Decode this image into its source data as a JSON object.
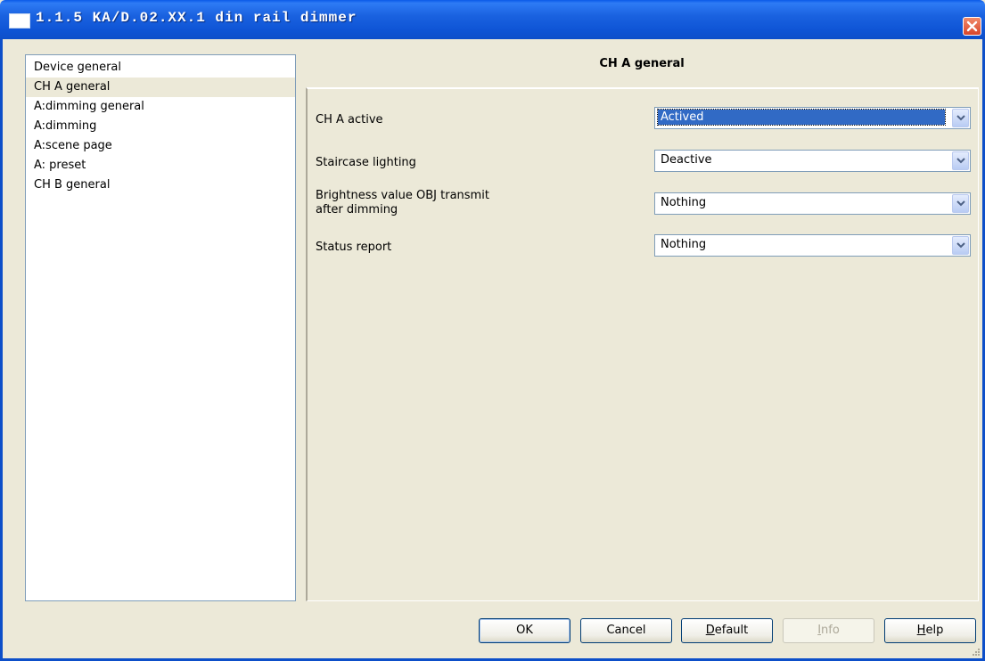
{
  "window": {
    "title": "1.1.5 KA/D.02.XX.1 din rail dimmer",
    "title_icon": "window-icon",
    "close_icon": "close-icon"
  },
  "nav": {
    "items": [
      {
        "label": "Device general",
        "selected": false
      },
      {
        "label": "CH A general",
        "selected": true
      },
      {
        "label": "A:dimming general",
        "selected": false
      },
      {
        "label": "A:dimming",
        "selected": false
      },
      {
        "label": "A:scene page",
        "selected": false
      },
      {
        "label": "A: preset",
        "selected": false
      },
      {
        "label": "CH B general",
        "selected": false
      }
    ]
  },
  "panel": {
    "title": "CH A general",
    "params": [
      {
        "label": "CH A active",
        "value": "Actived"
      },
      {
        "label": "Staircase lighting",
        "value": "Deactive"
      },
      {
        "label_line1": "Brightness value OBJ transmit",
        "label_line2": "after dimming",
        "value": "Nothing"
      },
      {
        "label": "Status report",
        "value": "Nothing"
      }
    ]
  },
  "buttons": {
    "ok": "OK",
    "cancel": "Cancel",
    "default_mn": "D",
    "default_rest": "efault",
    "info_mn": "I",
    "info_rest": "nfo",
    "help_mn": "H",
    "help_rest": "elp"
  },
  "colors": {
    "titlebar": "#0d4fc9",
    "face": "#ece9d8",
    "selection": "#316ac5"
  }
}
